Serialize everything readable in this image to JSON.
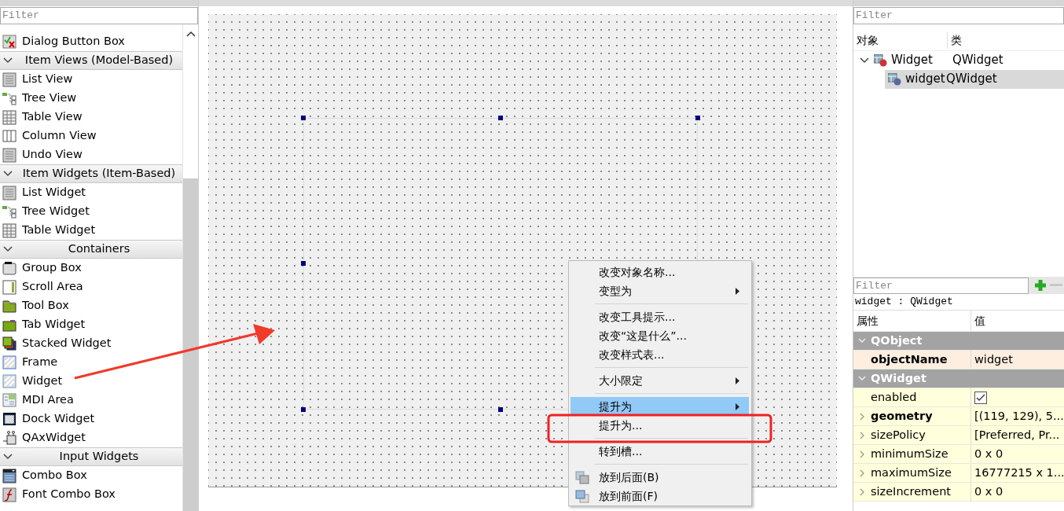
{
  "widget_box": {
    "filter": {
      "placeholder": "Filter"
    },
    "items": [
      {
        "kind": "widget",
        "label": "Dialog Button Box"
      },
      {
        "kind": "category",
        "label": "Item Views (Model-Based)",
        "expanded": true
      },
      {
        "kind": "widget",
        "label": "List View"
      },
      {
        "kind": "widget",
        "label": "Tree View"
      },
      {
        "kind": "widget",
        "label": "Table View"
      },
      {
        "kind": "widget",
        "label": "Column View"
      },
      {
        "kind": "widget",
        "label": "Undo View"
      },
      {
        "kind": "category",
        "label": "Item Widgets (Item-Based)",
        "expanded": true
      },
      {
        "kind": "widget",
        "label": "List Widget"
      },
      {
        "kind": "widget",
        "label": "Tree Widget"
      },
      {
        "kind": "widget",
        "label": "Table Widget"
      },
      {
        "kind": "category",
        "label": "Containers",
        "expanded": true
      },
      {
        "kind": "widget",
        "label": "Group Box"
      },
      {
        "kind": "widget",
        "label": "Scroll Area"
      },
      {
        "kind": "widget",
        "label": "Tool Box"
      },
      {
        "kind": "widget",
        "label": "Tab Widget"
      },
      {
        "kind": "widget",
        "label": "Stacked Widget"
      },
      {
        "kind": "widget",
        "label": "Frame"
      },
      {
        "kind": "widget",
        "label": "Widget"
      },
      {
        "kind": "widget",
        "label": "MDI Area"
      },
      {
        "kind": "widget",
        "label": "Dock Widget"
      },
      {
        "kind": "widget",
        "label": "QAxWidget"
      },
      {
        "kind": "category",
        "label": "Input Widgets",
        "expanded": true
      },
      {
        "kind": "widget",
        "label": "Combo Box"
      },
      {
        "kind": "widget",
        "label": "Font Combo Box"
      }
    ]
  },
  "context_menu": {
    "items": [
      {
        "kind": "action",
        "label": "改变对象名称...",
        "selected": false
      },
      {
        "kind": "submenu",
        "label": "变型为",
        "selected": false
      },
      {
        "kind": "separator"
      },
      {
        "kind": "action",
        "label": "改变工具提示...",
        "selected": false
      },
      {
        "kind": "action",
        "label": "改变“这是什么”...",
        "selected": false
      },
      {
        "kind": "action",
        "label": "改变样式表...",
        "selected": false
      },
      {
        "kind": "separator"
      },
      {
        "kind": "submenu",
        "label": "大小限定",
        "selected": false
      },
      {
        "kind": "separator"
      },
      {
        "kind": "submenu",
        "label": "提升为",
        "selected": true
      },
      {
        "kind": "action",
        "label": "提升为...",
        "selected": false
      },
      {
        "kind": "separator"
      },
      {
        "kind": "action",
        "label": "转到槽...",
        "selected": false
      },
      {
        "kind": "separator"
      },
      {
        "kind": "icon_action",
        "label": "放到后面(B)",
        "selected": false
      },
      {
        "kind": "icon_action",
        "label": "放到前面(F)",
        "selected": false
      }
    ]
  },
  "annotations": [
    {
      "kind": "arrow"
    },
    {
      "kind": "rectangle"
    }
  ],
  "object_inspector": {
    "filter": {
      "placeholder": "Filter"
    },
    "columns": [
      "对象",
      "类"
    ],
    "tree": [
      {
        "name": "Widget",
        "class": "QWidget",
        "selected": false,
        "expanded": true,
        "children": [
          {
            "name": "widget",
            "class": "QWidget",
            "selected": true
          }
        ]
      }
    ]
  },
  "property_editor": {
    "filter": {
      "placeholder": "Filter"
    },
    "object_label": "widget : QWidget",
    "columns": [
      "属性",
      "值"
    ],
    "groups": [
      {
        "name": "QObject",
        "expanded": true,
        "color": "#fdeee0",
        "properties": [
          {
            "name": "objectName",
            "value": "widget",
            "bold": true,
            "expandable": false
          }
        ]
      },
      {
        "name": "QWidget",
        "expanded": true,
        "color": "#ffffdc",
        "properties": [
          {
            "name": "enabled",
            "kind": "checkbox",
            "checked": true,
            "bold": false,
            "expandable": false
          },
          {
            "name": "geometry",
            "value": "[(119, 129), 5...",
            "bold": true,
            "expandable": true
          },
          {
            "name": "sizePolicy",
            "value": "[Preferred, Pr...",
            "bold": false,
            "expandable": true
          },
          {
            "name": "minimumSize",
            "value": "0 x 0",
            "bold": false,
            "expandable": true
          },
          {
            "name": "maximumSize",
            "value": "16777215 x 1...",
            "bold": false,
            "expandable": true
          },
          {
            "name": "sizeIncrement",
            "value": "0 x 0",
            "bold": false,
            "expandable": true
          }
        ]
      }
    ]
  }
}
